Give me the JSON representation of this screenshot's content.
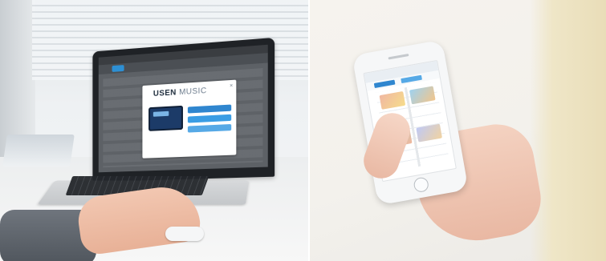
{
  "left_photo": {
    "modal": {
      "logo_bold": "USEN",
      "logo_light": "MUSIC",
      "close_glyph": "×"
    }
  },
  "colors": {
    "modal_button_blue": "#2f86cf",
    "nav_blue": "#2d8fd3"
  }
}
